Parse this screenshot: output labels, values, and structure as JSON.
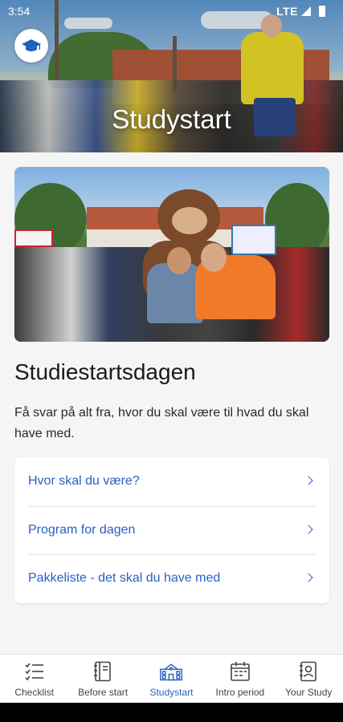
{
  "status_bar": {
    "time": "3:54",
    "network": "LTE"
  },
  "hero": {
    "title": "Studystart"
  },
  "article": {
    "title": "Studiestartsdagen",
    "description": "Få svar på alt fra, hvor du skal være til hvad du skal have med."
  },
  "links": [
    {
      "label": "Hvor skal du være?"
    },
    {
      "label": "Program for dagen"
    },
    {
      "label": "Pakkeliste - det skal du have med"
    }
  ],
  "bottom_nav": {
    "items": [
      {
        "label": "Checklist",
        "icon": "checklist-icon"
      },
      {
        "label": "Before start",
        "icon": "notebook-icon"
      },
      {
        "label": "Studystart",
        "icon": "school-building-icon",
        "active": true
      },
      {
        "label": "Intro period",
        "icon": "calendar-icon"
      },
      {
        "label": "Your Study",
        "icon": "contact-card-icon"
      }
    ]
  },
  "colors": {
    "accent": "#2b5fbf",
    "background": "#f5f5f5",
    "card": "#ffffff"
  }
}
